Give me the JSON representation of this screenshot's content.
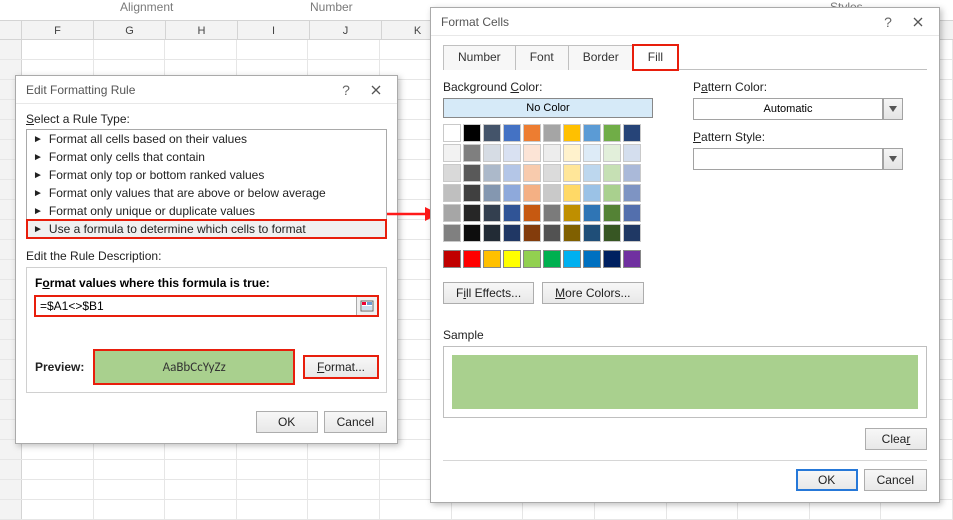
{
  "ribbon": {
    "group_alignment": "Alignment",
    "group_number": "Number",
    "group_styles": "Styles"
  },
  "columns": [
    "F",
    "G",
    "H",
    "I",
    "J",
    "K"
  ],
  "dlg_rule": {
    "title": "Edit Formatting Rule",
    "select_label": "Select a Rule Type:",
    "types": [
      "Format all cells based on their values",
      "Format only cells that contain",
      "Format only top or bottom ranked values",
      "Format only values that are above or below average",
      "Format only unique or duplicate values",
      "Use a formula to determine which cells to format"
    ],
    "edit_desc_label": "Edit the Rule Description:",
    "formula_label": "Format values where this formula is true:",
    "formula_value": "=$A1<>$B1",
    "preview_label": "Preview:",
    "preview_text": "AaBbCcYyZz",
    "format_btn": "Format...",
    "ok": "OK",
    "cancel": "Cancel"
  },
  "dlg_format": {
    "title": "Format Cells",
    "tabs": [
      "Number",
      "Font",
      "Border",
      "Fill"
    ],
    "active_tab": "Fill",
    "bg_label": "Background Color:",
    "no_color": "No Color",
    "pattern_color_label": "Pattern Color:",
    "pattern_color_value": "Automatic",
    "pattern_style_label": "Pattern Style:",
    "fill_effects_btn": "Fill Effects...",
    "more_colors_btn": "More Colors...",
    "sample_label": "Sample",
    "clear_btn": "Clear",
    "ok": "OK",
    "cancel": "Cancel",
    "theme_rows": [
      [
        "#ffffff",
        "#000000",
        "#44546a",
        "#4472c4",
        "#ed7d31",
        "#a5a5a5",
        "#ffc000",
        "#5b9bd5",
        "#70ad47",
        "#264478"
      ],
      [
        "#f2f2f2",
        "#7f7f7f",
        "#d6dce4",
        "#d9e1f2",
        "#fce4d6",
        "#ededed",
        "#fff2cc",
        "#ddebf7",
        "#e2efda",
        "#d4deee"
      ],
      [
        "#d9d9d9",
        "#595959",
        "#acb9ca",
        "#b4c6e7",
        "#f8cbad",
        "#dbdbdb",
        "#ffe699",
        "#bdd7ee",
        "#c6e0b4",
        "#aab9d9"
      ],
      [
        "#bfbfbf",
        "#404040",
        "#8497b0",
        "#8ea9db",
        "#f4b084",
        "#c9c9c9",
        "#ffd966",
        "#9bc2e6",
        "#a9d08e",
        "#7e94c3"
      ],
      [
        "#a6a6a6",
        "#262626",
        "#333f4f",
        "#305496",
        "#c65911",
        "#7b7b7b",
        "#bf8f00",
        "#2f75b5",
        "#548235",
        "#536fad"
      ],
      [
        "#808080",
        "#0d0d0d",
        "#222b35",
        "#203764",
        "#833c0c",
        "#525252",
        "#806000",
        "#1f4e78",
        "#375623",
        "#1f3864"
      ]
    ],
    "standard_colors": [
      "#c00000",
      "#ff0000",
      "#ffc000",
      "#ffff00",
      "#92d050",
      "#00b050",
      "#00b0f0",
      "#0070c0",
      "#002060",
      "#7030a0"
    ]
  }
}
